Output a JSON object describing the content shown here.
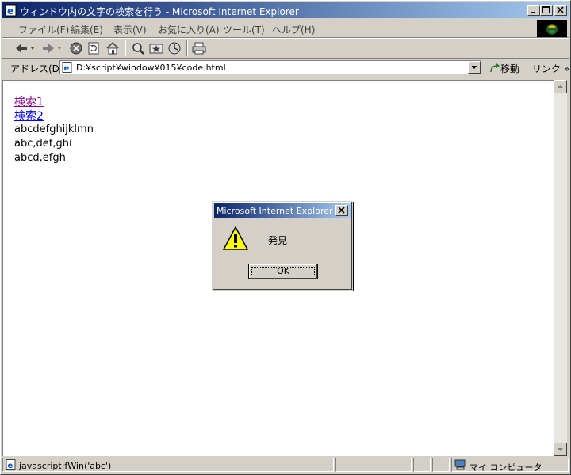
{
  "window": {
    "title": "ウィンドウ内の文字の検索を行う - Microsoft Internet Explorer"
  },
  "menu": {
    "items": [
      "ファイル(F)",
      "編集(E)",
      "表示(V)",
      "お気に入り(A)",
      "ツール(T)",
      "ヘルプ(H)"
    ]
  },
  "address": {
    "label": "アドレス(D)",
    "value": "D:¥script¥window¥015¥code.html",
    "go_label": "移動",
    "links_label": "リンク »"
  },
  "page": {
    "links": [
      "検索1",
      "検索2"
    ],
    "lines": [
      "abcdefghijklmn",
      "abc,def,ghi",
      "abcd,efgh"
    ],
    "link_color": "#800080",
    "link2_color": "#0000ff"
  },
  "dialog": {
    "title": "Microsoft Internet Explorer",
    "message": "発見",
    "ok_label": "OK"
  },
  "status": {
    "text": "javascript:fWin('abc')",
    "zone": "マイ コンピュータ"
  },
  "colors": {
    "title_start": "#0a246a",
    "title_end": "#a6caf0",
    "chrome": "#d4d0c8"
  }
}
